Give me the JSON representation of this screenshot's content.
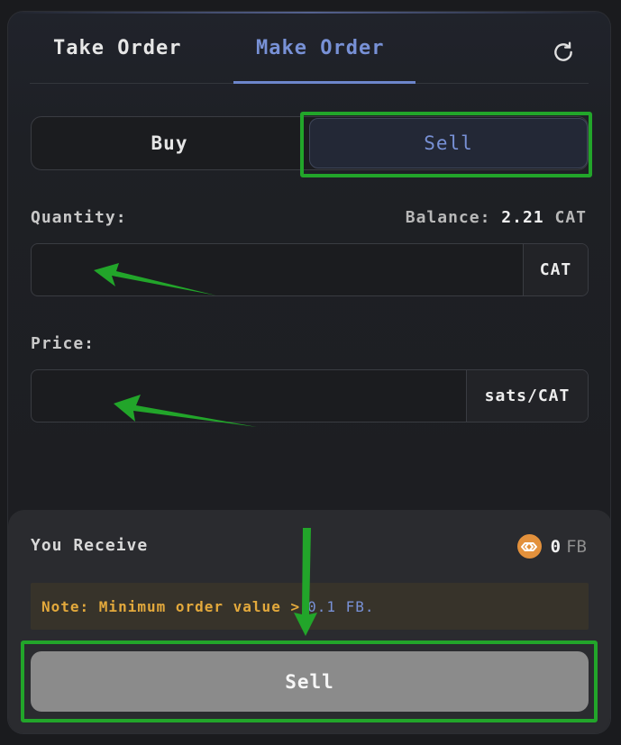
{
  "tabs": [
    {
      "label": "Take Order",
      "active": false
    },
    {
      "label": "Make Order",
      "active": true
    }
  ],
  "side_toggle": {
    "buy_label": "Buy",
    "sell_label": "Sell",
    "selected": "Sell"
  },
  "quantity": {
    "label": "Quantity:",
    "value": "",
    "unit": "CAT"
  },
  "balance": {
    "label": "Balance:",
    "value": "2.21",
    "unit": "CAT"
  },
  "price": {
    "label": "Price:",
    "value": "",
    "unit": "sats/CAT"
  },
  "receive": {
    "label": "You Receive",
    "amount": "0",
    "unit": "FB",
    "coin_icon": "fractal-coin-icon"
  },
  "note": {
    "text": "Note: Minimum order value >",
    "highlight": "0.1 FB."
  },
  "submit": {
    "label": "Sell"
  },
  "colors": {
    "accent": "#7891d6",
    "warning": "#e3a93c",
    "annotation": "#22a52a",
    "submit_bg": "#8b8b8b",
    "coin": "#e3913c"
  }
}
